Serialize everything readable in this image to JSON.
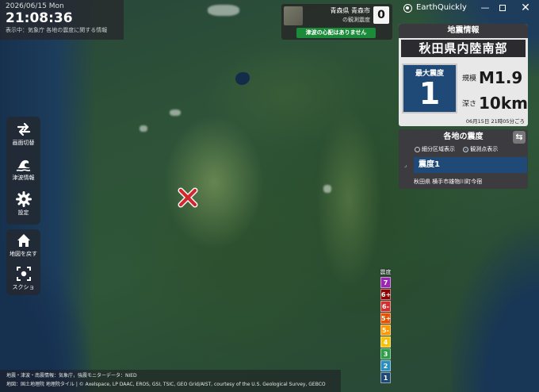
{
  "clock": {
    "date": "2026/06/15 Mon",
    "time": "21:08:36",
    "source": "表示中：気象庁 各地の震度に関する情報"
  },
  "observation": {
    "place": "青森県 青森市",
    "subtitle": "の観測震度",
    "count": "0",
    "tsunami_message": "津波の心配はありません"
  },
  "app": {
    "title": "EarthQuickly",
    "minimize": "—",
    "close": "✕"
  },
  "earthquake": {
    "header": "地震情報",
    "region": "秋田県内陸南部",
    "intensity_label": "最大震度",
    "intensity": "1",
    "magnitude_key": "規模",
    "magnitude": "M1.9",
    "depth_key": "深さ",
    "depth": "10km",
    "time": "06月15日 21時05分ごろ"
  },
  "regional": {
    "header": "各地の震度",
    "refresh_icon": "⇆",
    "options": [
      "細分区域表示",
      "観測点表示"
    ],
    "selected_option": "観測点表示",
    "bullet": "⌟",
    "entry": "震度1",
    "station": "秋田県 横手市雄物川町今宿"
  },
  "toolbar": {
    "switch_label": "画面切替",
    "tsunami_label": "津波情報",
    "settings_label": "設定",
    "home_label": "地図を戻す",
    "screenshot_label": "スクショ"
  },
  "legend": {
    "title": "震度",
    "levels": [
      {
        "label": "7",
        "color": "#9c27b0"
      },
      {
        "label": "6+",
        "color": "#8b0000"
      },
      {
        "label": "6-",
        "color": "#d32f2f"
      },
      {
        "label": "5+",
        "color": "#e65100"
      },
      {
        "label": "5-",
        "color": "#ff9800"
      },
      {
        "label": "4",
        "color": "#f4c20d"
      },
      {
        "label": "3",
        "color": "#2e9e4a"
      },
      {
        "label": "2",
        "color": "#2a8fbf"
      },
      {
        "label": "1",
        "color": "#1f4a78"
      }
    ]
  },
  "attribution": {
    "line1": "地震・津波・南震情報：気象庁，強震モニターデータ：NIED",
    "line2": "地図：国土地理院 地理院タイル | © Axelspace, LP DAAC, EROS, GSI, TSIC, GEO Grid/AIST, courtesy of the U.S. Geological Survey, GEBCO"
  },
  "colors": {
    "intensity_1": "#1f4a78",
    "tsunami_ok": "#1b8a3a",
    "epicenter": "#d0282c"
  }
}
